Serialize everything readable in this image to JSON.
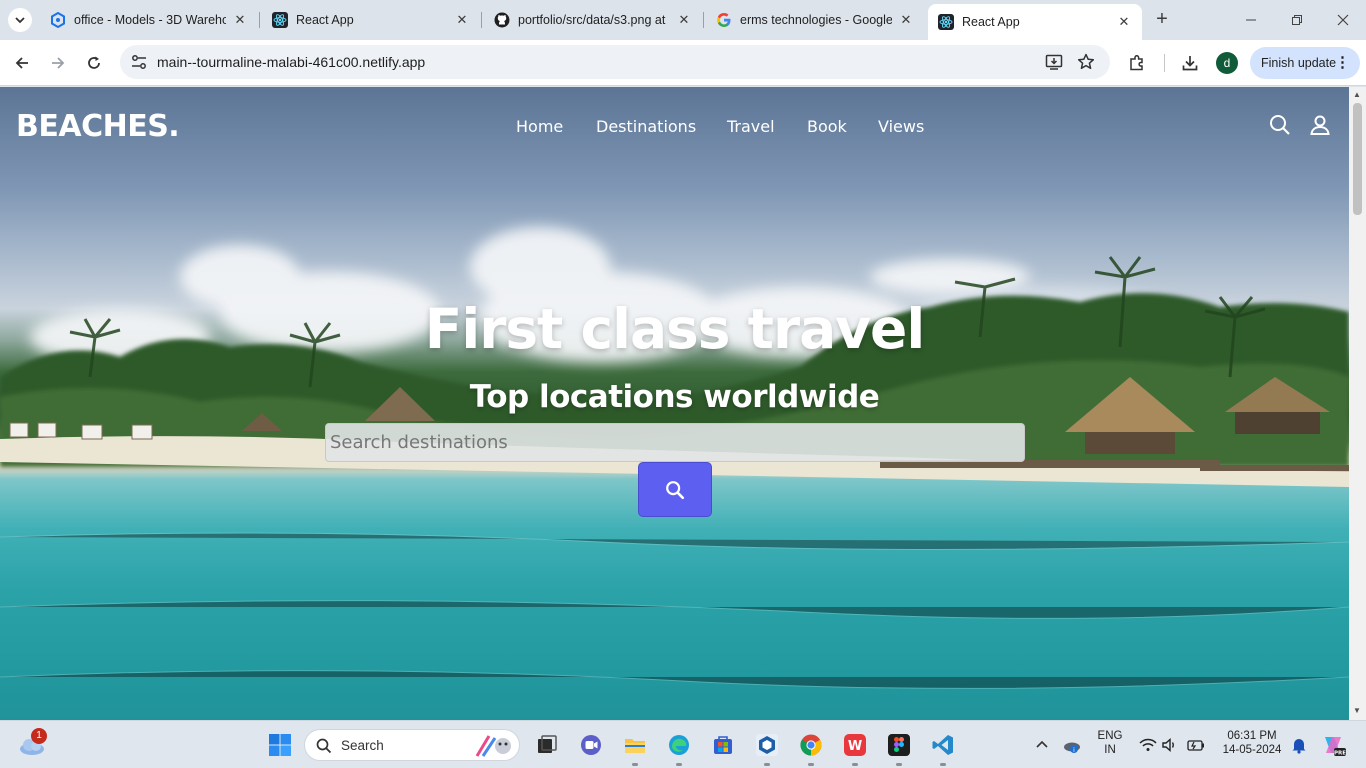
{
  "browser": {
    "tabs": [
      {
        "title": "office - Models - 3D Wareho",
        "icon": "sketchup-icon"
      },
      {
        "title": "React App",
        "icon": "react-icon"
      },
      {
        "title": "portfolio/src/data/s3.png at",
        "icon": "github-icon"
      },
      {
        "title": "erms technologies - Google",
        "icon": "google-icon"
      },
      {
        "title": "React App",
        "icon": "react-icon",
        "active": true
      }
    ],
    "url": "main--tourmaline-malabi-461c00.netlify.app",
    "profile_initial": "d",
    "finish_update_label": "Finish update"
  },
  "site": {
    "logo": "BEACHES.",
    "nav": [
      "Home",
      "Destinations",
      "Travel",
      "Book",
      "Views"
    ],
    "hero_title": "First class travel",
    "hero_subtitle": "Top locations worldwide",
    "search_placeholder": "Search destinations",
    "accent_color": "#5d5ff0"
  },
  "taskbar": {
    "search_label": "Search",
    "weather_badge": "1",
    "lang_top": "ENG",
    "lang_bottom": "IN",
    "time": "06:31 PM",
    "date": "14-05-2024"
  }
}
